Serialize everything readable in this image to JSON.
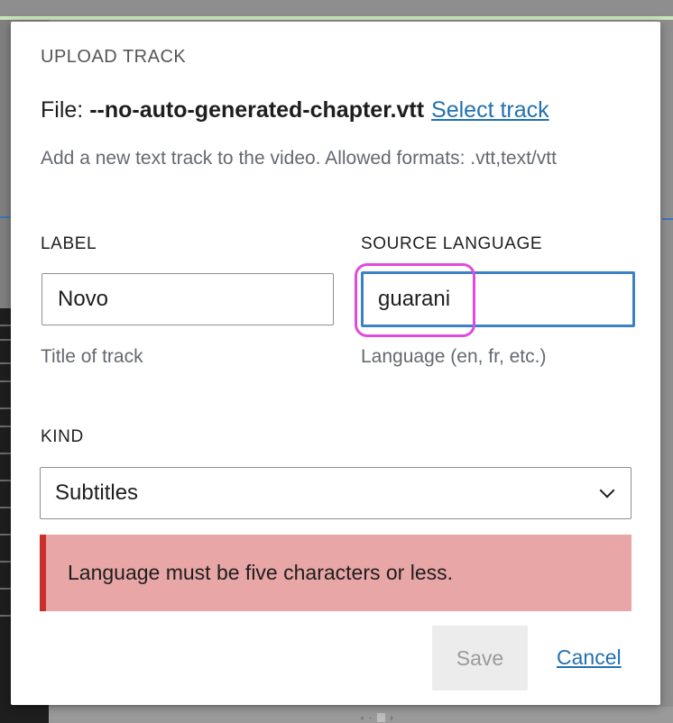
{
  "modal": {
    "title": "UPLOAD TRACK",
    "file_prefix": "File: ",
    "file_name": "--no-auto-generated-chapter.vtt",
    "select_track_label": "Select track",
    "help_text": "Add a new text track to the video. Allowed formats: .vtt,text/vtt"
  },
  "label_field": {
    "label": "LABEL",
    "value": "Novo",
    "hint": "Title of track"
  },
  "source_language_field": {
    "label": "SOURCE LANGUAGE",
    "value": "guarani",
    "hint": "Language (en, fr, etc.)"
  },
  "kind_field": {
    "label": "KIND",
    "selected": "Subtitles"
  },
  "error": {
    "message": "Language must be five characters or less."
  },
  "actions": {
    "save_label": "Save",
    "cancel_label": "Cancel"
  },
  "colors": {
    "link": "#2271b1",
    "error_background": "#e8a6a6",
    "error_border": "#c9302c",
    "focus_border": "#3a82c4",
    "annotation": "#e04bde"
  }
}
